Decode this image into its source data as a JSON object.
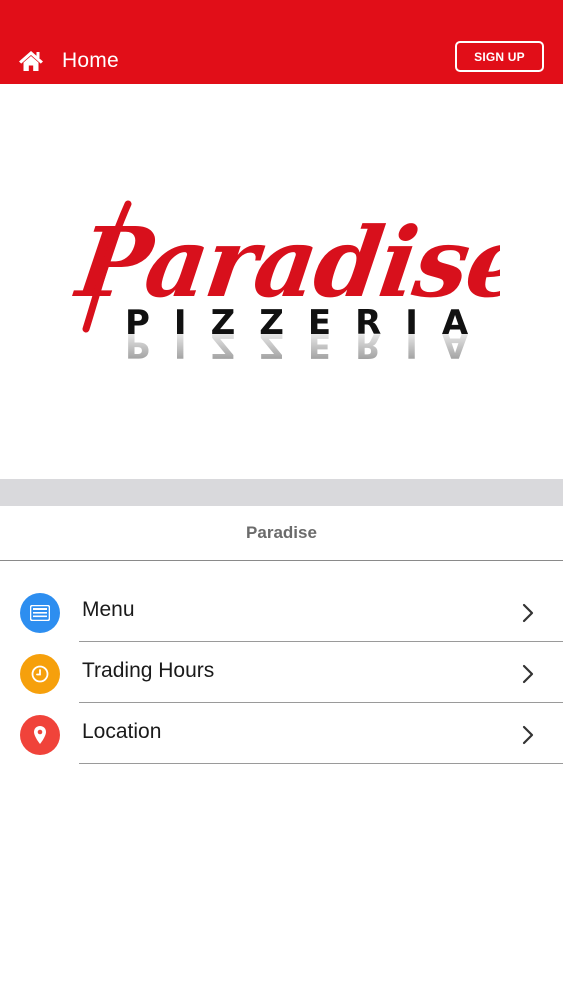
{
  "header": {
    "home_label": "Home",
    "signup_label": "SIGN UP",
    "background_color": "#e10e18"
  },
  "logo": {
    "script_text": "Paradise",
    "sub_text": "PIZZERIA",
    "brand_color": "#d8101c"
  },
  "section": {
    "title": "Paradise"
  },
  "list": {
    "items": [
      {
        "label": "Menu",
        "icon": "menu-list-icon",
        "icon_color": "#2d8ef0"
      },
      {
        "label": "Trading Hours",
        "icon": "clock-icon",
        "icon_color": "#f6a00c"
      },
      {
        "label": "Location",
        "icon": "location-pin-icon",
        "icon_color": "#f0433a"
      }
    ]
  }
}
